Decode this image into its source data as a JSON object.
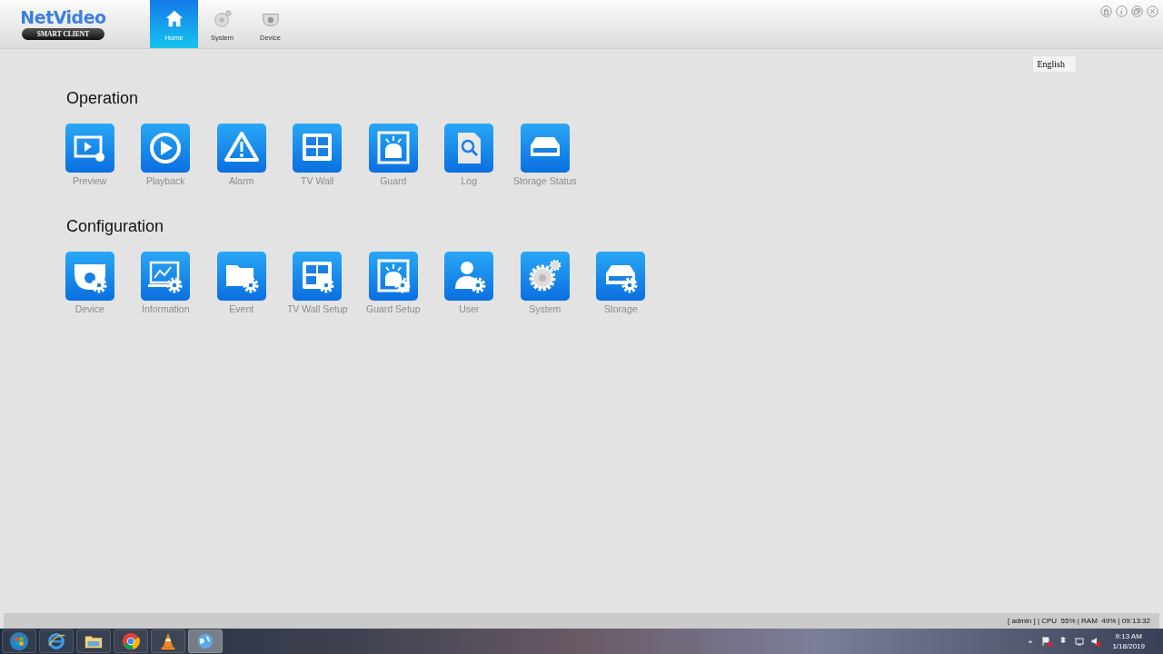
{
  "header": {
    "logo": {
      "title": "NetVideo",
      "subtitle": "SMART CLIENT"
    },
    "tabs": [
      {
        "label": "Home",
        "kind": "home",
        "selected": true
      },
      {
        "label": "System",
        "kind": "system",
        "selected": false
      },
      {
        "label": "Device",
        "kind": "device",
        "selected": false
      }
    ],
    "window_controls": [
      {
        "kind": "lock"
      },
      {
        "kind": "info"
      },
      {
        "kind": "restore"
      },
      {
        "kind": "close"
      }
    ],
    "language": "English"
  },
  "sections": [
    {
      "title": "Operation",
      "tiles": [
        {
          "label": "Preview",
          "kind": "preview"
        },
        {
          "label": "Playback",
          "kind": "playback"
        },
        {
          "label": "Alarm",
          "kind": "alarm"
        },
        {
          "label": "TV Wall",
          "kind": "tvwall"
        },
        {
          "label": "Guard",
          "kind": "guard"
        },
        {
          "label": "Log",
          "kind": "log"
        },
        {
          "label": "Storage Status",
          "kind": "storage"
        }
      ]
    },
    {
      "title": "Configuration",
      "tiles": [
        {
          "label": "Device",
          "kind": "device-setup"
        },
        {
          "label": "Information",
          "kind": "information"
        },
        {
          "label": "Event",
          "kind": "event"
        },
        {
          "label": "TV Wall Setup",
          "kind": "tvwall-setup"
        },
        {
          "label": "Guard Setup",
          "kind": "guard-setup"
        },
        {
          "label": "User",
          "kind": "user"
        },
        {
          "label": "System",
          "kind": "system-setup"
        },
        {
          "label": "Storage",
          "kind": "storage-setup"
        }
      ]
    }
  ],
  "status_bar": "[ admin ] | CPU  55% | RAM  49% | 09:13:32",
  "taskbar": {
    "apps": [
      {
        "kind": "start",
        "selected": false
      },
      {
        "kind": "ie",
        "selected": false
      },
      {
        "kind": "folder",
        "selected": false
      },
      {
        "kind": "chrome",
        "selected": false
      },
      {
        "kind": "cone",
        "selected": false
      },
      {
        "kind": "globe",
        "selected": true
      }
    ],
    "tray": [
      {
        "kind": "arrow"
      },
      {
        "kind": "flag"
      },
      {
        "kind": "box"
      },
      {
        "kind": "network"
      },
      {
        "kind": "speaker"
      }
    ],
    "clock": {
      "time": "9:13 AM",
      "date": "1/18/2019"
    }
  }
}
